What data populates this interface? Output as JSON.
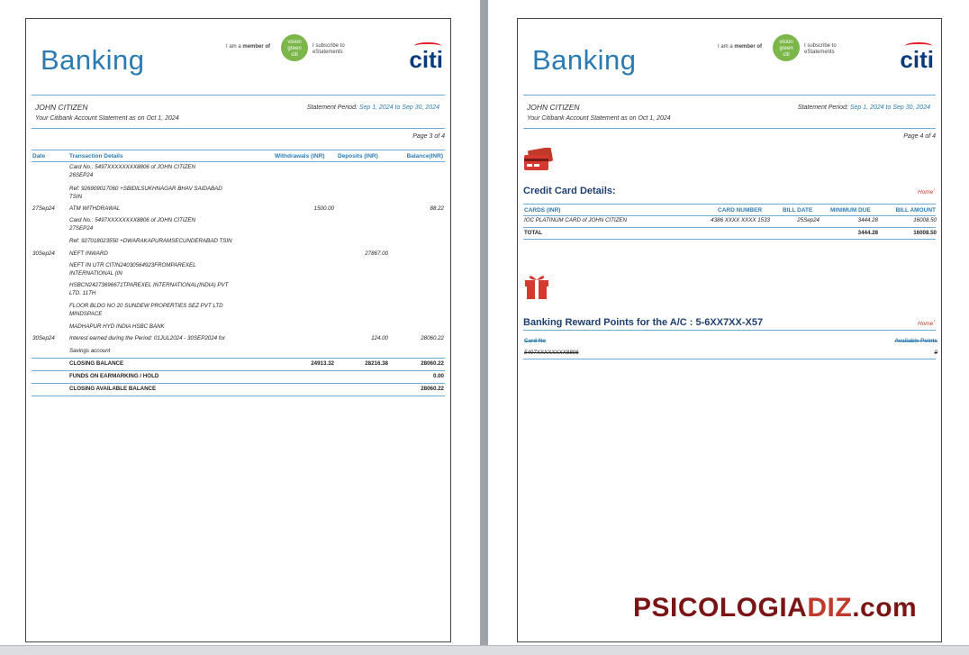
{
  "brand": "Banking",
  "member_prefix": "I am a",
  "member_bold": "member of",
  "vg_top": "vision",
  "vg_mid": "green",
  "vg_bot": "citi",
  "subscribe_1": "I subscribe to",
  "subscribe_2": "eStatements",
  "citi_logo": "citi",
  "customer_name": "JOHN CITIZEN",
  "customer_sub": "Your Citibank Account Statement as on Oct 1, 2024",
  "period_label": "Statement Period:",
  "period_range": "Sep 1, 2024 to Sep 30, 2024",
  "page1": {
    "page_no": "Page 3 of 4",
    "headers": {
      "date": "Date",
      "details": "Transaction Details",
      "withdrawals": "Withdrawals (INR)",
      "deposits": "Deposits (INR)",
      "balance": "Balance(INR)"
    },
    "lines": [
      {
        "date": "",
        "text": "Card No.: 5497XXXXXXXX8806 of JOHN CITIZEN",
        "w": "",
        "d": "",
        "b": ""
      },
      {
        "date": "",
        "text": "26SEP24",
        "w": "",
        "d": "",
        "b": ""
      },
      {
        "date": "",
        "text": "Ref: 926909017060 +SBIDILSUKHNAGAR BHAV SAIDABAD",
        "w": "",
        "d": "",
        "b": ""
      },
      {
        "date": "",
        "text": "TSIN",
        "w": "",
        "d": "",
        "b": ""
      },
      {
        "date": "27Sep24",
        "text": "ATM WITHDRAWAL",
        "w": "1500.00",
        "d": "",
        "b": "88.22"
      },
      {
        "date": "",
        "text": "Card No.: 5497XXXXXXXX8806 of JOHN CITIZEN",
        "w": "",
        "d": "",
        "b": ""
      },
      {
        "date": "",
        "text": "27SEP24",
        "w": "",
        "d": "",
        "b": ""
      },
      {
        "date": "",
        "text": "Ref: 927018023550 +DWARAKAPURAMSECUNDERABAD TSIN",
        "w": "",
        "d": "",
        "b": ""
      },
      {
        "date": "30Sep24",
        "text": "NEFT INWARD",
        "w": "",
        "d": "27867.00",
        "b": ""
      },
      {
        "date": "",
        "text": "NEFT IN UTR CITIN24030564923FROMPAREXEL",
        "w": "",
        "d": "",
        "b": ""
      },
      {
        "date": "",
        "text": "INTERNATIONAL (IN",
        "w": "",
        "d": "",
        "b": ""
      },
      {
        "date": "",
        "text": "HSBCN24273696671TPAREXEL INTERNATIONAL(INDIA) PVT",
        "w": "",
        "d": "",
        "b": ""
      },
      {
        "date": "",
        "text": "LTD. 11TH",
        "w": "",
        "d": "",
        "b": ""
      },
      {
        "date": "",
        "text": "FLOOR BLDG NO 20 SUNDEW PROPERTIES SEZ PVT LTD",
        "w": "",
        "d": "",
        "b": ""
      },
      {
        "date": "",
        "text": "MINDSPACE",
        "w": "",
        "d": "",
        "b": ""
      },
      {
        "date": "",
        "text": "MADHAPUR HYD INDIA HSBC BANK",
        "w": "",
        "d": "",
        "b": ""
      },
      {
        "date": "30Sep24",
        "text": "Interest earned during the Period: 01JUL2024 - 30SEP2024 for",
        "w": "",
        "d": "124.00",
        "b": "28060.22"
      },
      {
        "date": "",
        "text": "Savings account",
        "w": "",
        "d": "",
        "b": ""
      }
    ],
    "totals": [
      {
        "label": "CLOSING BALANCE",
        "w": "24913.32",
        "d": "28216.38",
        "b": "28060.22"
      },
      {
        "label": "FUNDS ON EARMARKING / HOLD",
        "w": "",
        "d": "",
        "b": "0.00"
      },
      {
        "label": "CLOSING AVAILABLE BALANCE",
        "w": "",
        "d": "",
        "b": "28060.22"
      }
    ]
  },
  "page2": {
    "page_no": "Page 4 of 4",
    "cc_title": "Credit Card Details:",
    "home": "Home",
    "cc_headers": {
      "cards": "CARDS (INR)",
      "number": "CARD NUMBER",
      "bill_date": "BILL DATE",
      "min_due": "MINIMUM DUE",
      "bill_amt": "BILL AMOUNT"
    },
    "cc_row": {
      "card": "IOC PLATINUM CARD   of JOHN CITIZEN",
      "number": "4386 XXXX XXXX 1533",
      "bill_date": "25Sep24",
      "min_due": "3444.28",
      "bill_amt": "16008.50"
    },
    "cc_total": {
      "label": "TOTAL",
      "min_due": "3444.28",
      "bill_amt": "16008.50"
    },
    "rp_title": "Banking Reward Points for the A/C :  5-6XX7XX-X57",
    "rp_headers": {
      "card": "Card No",
      "points": "Available Points"
    },
    "rp_row": {
      "card": "5497XXXXXXXX8806",
      "points": "0"
    }
  },
  "watermark": {
    "part1": "PSICOLOGIA",
    "part2": "DIZ",
    "part3": ".com"
  }
}
